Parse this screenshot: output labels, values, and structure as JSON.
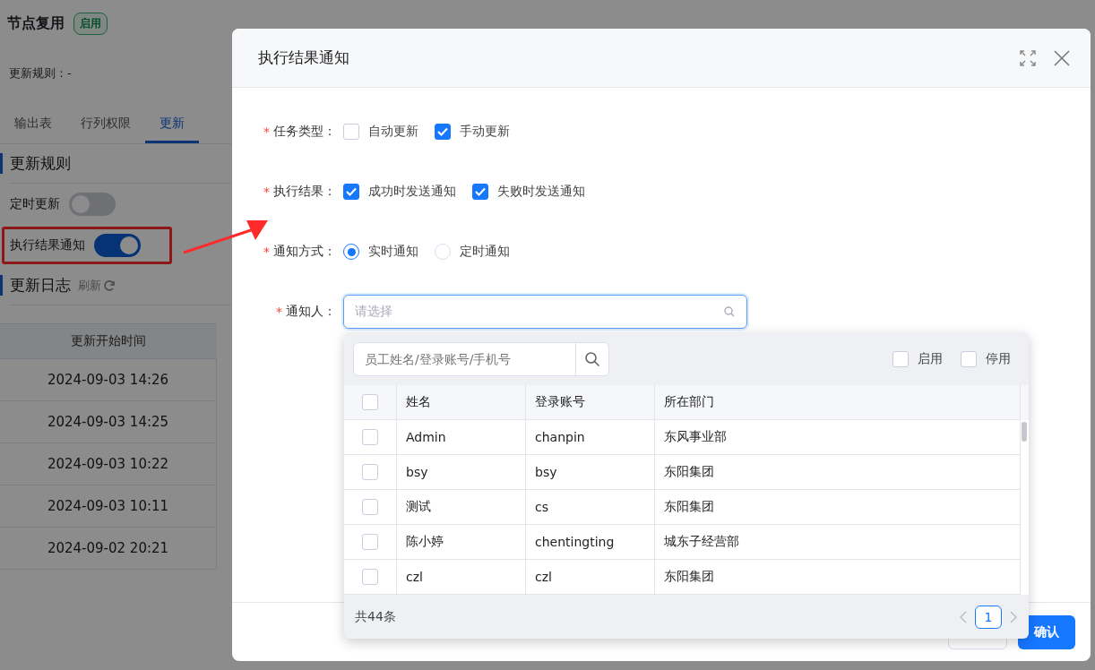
{
  "page": {
    "title": "节点复用",
    "status_badge": "启用",
    "rule_text": "更新规则：-",
    "tabs": [
      {
        "label": "输出表",
        "selected": false
      },
      {
        "label": "行列权限",
        "selected": false
      },
      {
        "label": "更新",
        "selected": true
      }
    ],
    "rule_section": "更新规则",
    "toggles": [
      {
        "label": "定时更新",
        "on": false,
        "highlighted": false
      },
      {
        "label": "执行结果通知",
        "on": true,
        "highlighted": true
      }
    ],
    "log_section": "更新日志",
    "refresh": "刷新",
    "log_table": {
      "columns": [
        "更新开始时间"
      ],
      "rows": [
        [
          "2024-09-03 14:26"
        ],
        [
          "2024-09-03 14:25"
        ],
        [
          "2024-09-03 10:22"
        ],
        [
          "2024-09-03 10:11"
        ],
        [
          "2024-09-02 20:21"
        ]
      ]
    }
  },
  "modal": {
    "title": "执行结果通知",
    "fields": [
      {
        "kind": "checkbox",
        "label": "任务类型：",
        "required_mark": "*",
        "options": [
          {
            "label": "自动更新",
            "checked": false
          },
          {
            "label": "手动更新",
            "checked": true
          }
        ]
      },
      {
        "kind": "checkbox",
        "label": "执行结果：",
        "required_mark": "*",
        "options": [
          {
            "label": "成功时发送通知",
            "checked": true
          },
          {
            "label": "失败时发送通知",
            "checked": true
          }
        ]
      },
      {
        "kind": "radio",
        "label": "通知方式：",
        "required_mark": "*",
        "options": [
          {
            "label": "实时通知",
            "selected": true
          },
          {
            "label": "定时通知",
            "selected": false
          }
        ]
      },
      {
        "kind": "select",
        "label": "通知人：",
        "required_mark": "*",
        "placeholder": "请选择"
      }
    ],
    "dropdown": {
      "search_placeholder": "员工姓名/登录账号/手机号",
      "filters": [
        {
          "label": "启用",
          "checked": false
        },
        {
          "label": "停用",
          "checked": false
        }
      ],
      "columns": [
        "姓名",
        "登录账号",
        "所在部门"
      ],
      "all_checked": false,
      "rows": [
        {
          "checked": false,
          "cells": [
            "Admin",
            "chanpin",
            "东风事业部"
          ]
        },
        {
          "checked": false,
          "cells": [
            "bsy",
            "bsy",
            "东阳集团"
          ]
        },
        {
          "checked": false,
          "cells": [
            "测试",
            "cs",
            "东阳集团"
          ]
        },
        {
          "checked": false,
          "cells": [
            "陈小婷",
            "chentingting",
            "城东子经营部"
          ]
        },
        {
          "checked": false,
          "cells": [
            "czl",
            "czl",
            "东阳集团"
          ]
        }
      ],
      "total": "共44条",
      "pages": [
        {
          "label": "1",
          "selected": true
        }
      ]
    },
    "confirm": "确认"
  }
}
